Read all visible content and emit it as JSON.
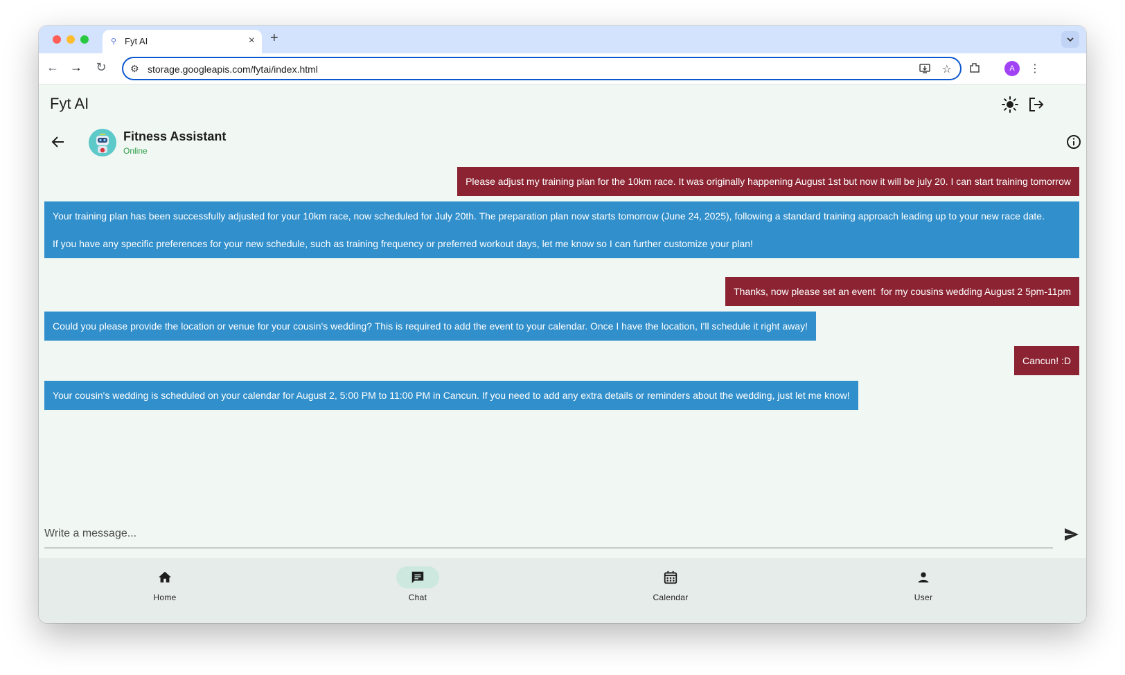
{
  "browser": {
    "tab_title": "Fyt AI",
    "url": "storage.googleapis.com/fytai/index.html",
    "profile_initial": "A"
  },
  "app": {
    "title": "Fyt AI"
  },
  "chat_header": {
    "name": "Fitness Assistant",
    "status": "Online"
  },
  "messages": [
    {
      "role": "user",
      "text": "Please adjust my training plan for the 10km race. It was originally happening August 1st but now it will be july 20. I can start training tomorrow"
    },
    {
      "role": "bot",
      "text": "Your training plan has been successfully adjusted for your 10km race, now scheduled for July 20th. The preparation plan now starts tomorrow (June 24, 2025), following a standard training approach leading up to your new race date.\n\nIf you have any specific preferences for your new schedule, such as training frequency or preferred workout days, let me know so I can further customize your plan!"
    },
    {
      "role": "user",
      "text": "Thanks, now please set an event  for my cousins wedding August 2 5pm-11pm"
    },
    {
      "role": "bot",
      "text": "Could you please provide the location or venue for your cousin's wedding? This is required to add the event to your calendar. Once I have the location, I'll schedule it right away!"
    },
    {
      "role": "user",
      "text": "Cancun! :D"
    },
    {
      "role": "bot",
      "text": "Your cousin's wedding is scheduled on your calendar for August 2, 5:00 PM to 11:00 PM in Cancun. If you need to add any extra details or reminders about the wedding, just let me know!"
    }
  ],
  "composer": {
    "placeholder": "Write a message..."
  },
  "bottom_nav": [
    {
      "label": "Home",
      "icon": "home-icon",
      "active": false
    },
    {
      "label": "Chat",
      "icon": "chat-icon",
      "active": true
    },
    {
      "label": "Calendar",
      "icon": "calendar-icon",
      "active": false
    },
    {
      "label": "User",
      "icon": "user-icon",
      "active": false
    }
  ],
  "colors": {
    "user_bubble": "#8b2332",
    "bot_bubble": "#318fcb",
    "app_background": "#f1f8f4",
    "status_online": "#2e9e48"
  }
}
